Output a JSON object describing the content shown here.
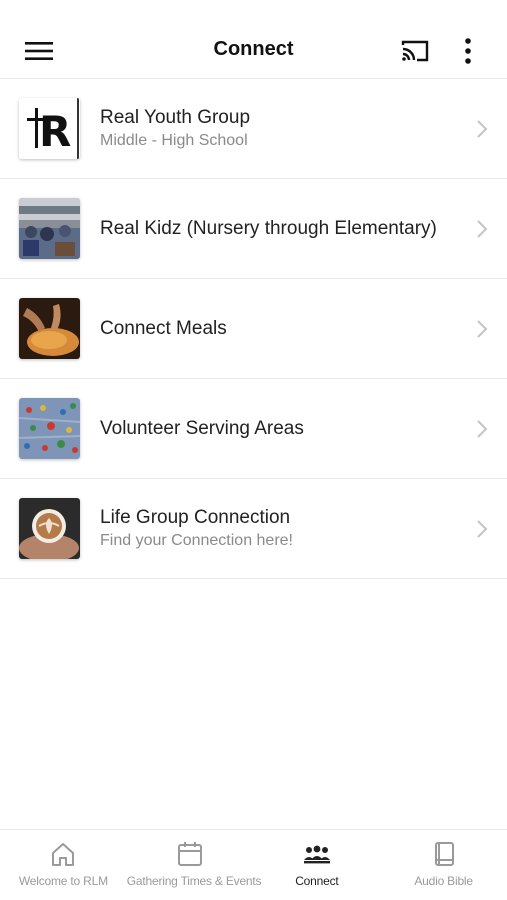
{
  "app_bar": {
    "title": "Connect",
    "menu_icon": "hamburger-menu-icon",
    "cast_icon": "cast-icon",
    "more_icon": "more-vertical-icon"
  },
  "list": {
    "items": [
      {
        "title": "Real Youth Group",
        "subtitle": "Middle - High School",
        "logo_text": "R"
      },
      {
        "title": "Real Kidz (Nursery through Elementary)",
        "subtitle": ""
      },
      {
        "title": "Connect Meals",
        "subtitle": ""
      },
      {
        "title": "Volunteer Serving Areas",
        "subtitle": ""
      },
      {
        "title": "Life Group Connection",
        "subtitle": "Find your Connection here!"
      }
    ]
  },
  "tabs": [
    {
      "label": "Welcome to RLM",
      "icon": "home-icon",
      "active": false
    },
    {
      "label": "Gathering Times & Events",
      "icon": "calendar-icon",
      "active": false
    },
    {
      "label": "Connect",
      "icon": "group-icon",
      "active": true
    },
    {
      "label": "Audio Bible",
      "icon": "book-icon",
      "active": false
    }
  ],
  "colors": {
    "active": "#222222",
    "inactive": "#9a9a9a",
    "divider": "#ececec"
  }
}
